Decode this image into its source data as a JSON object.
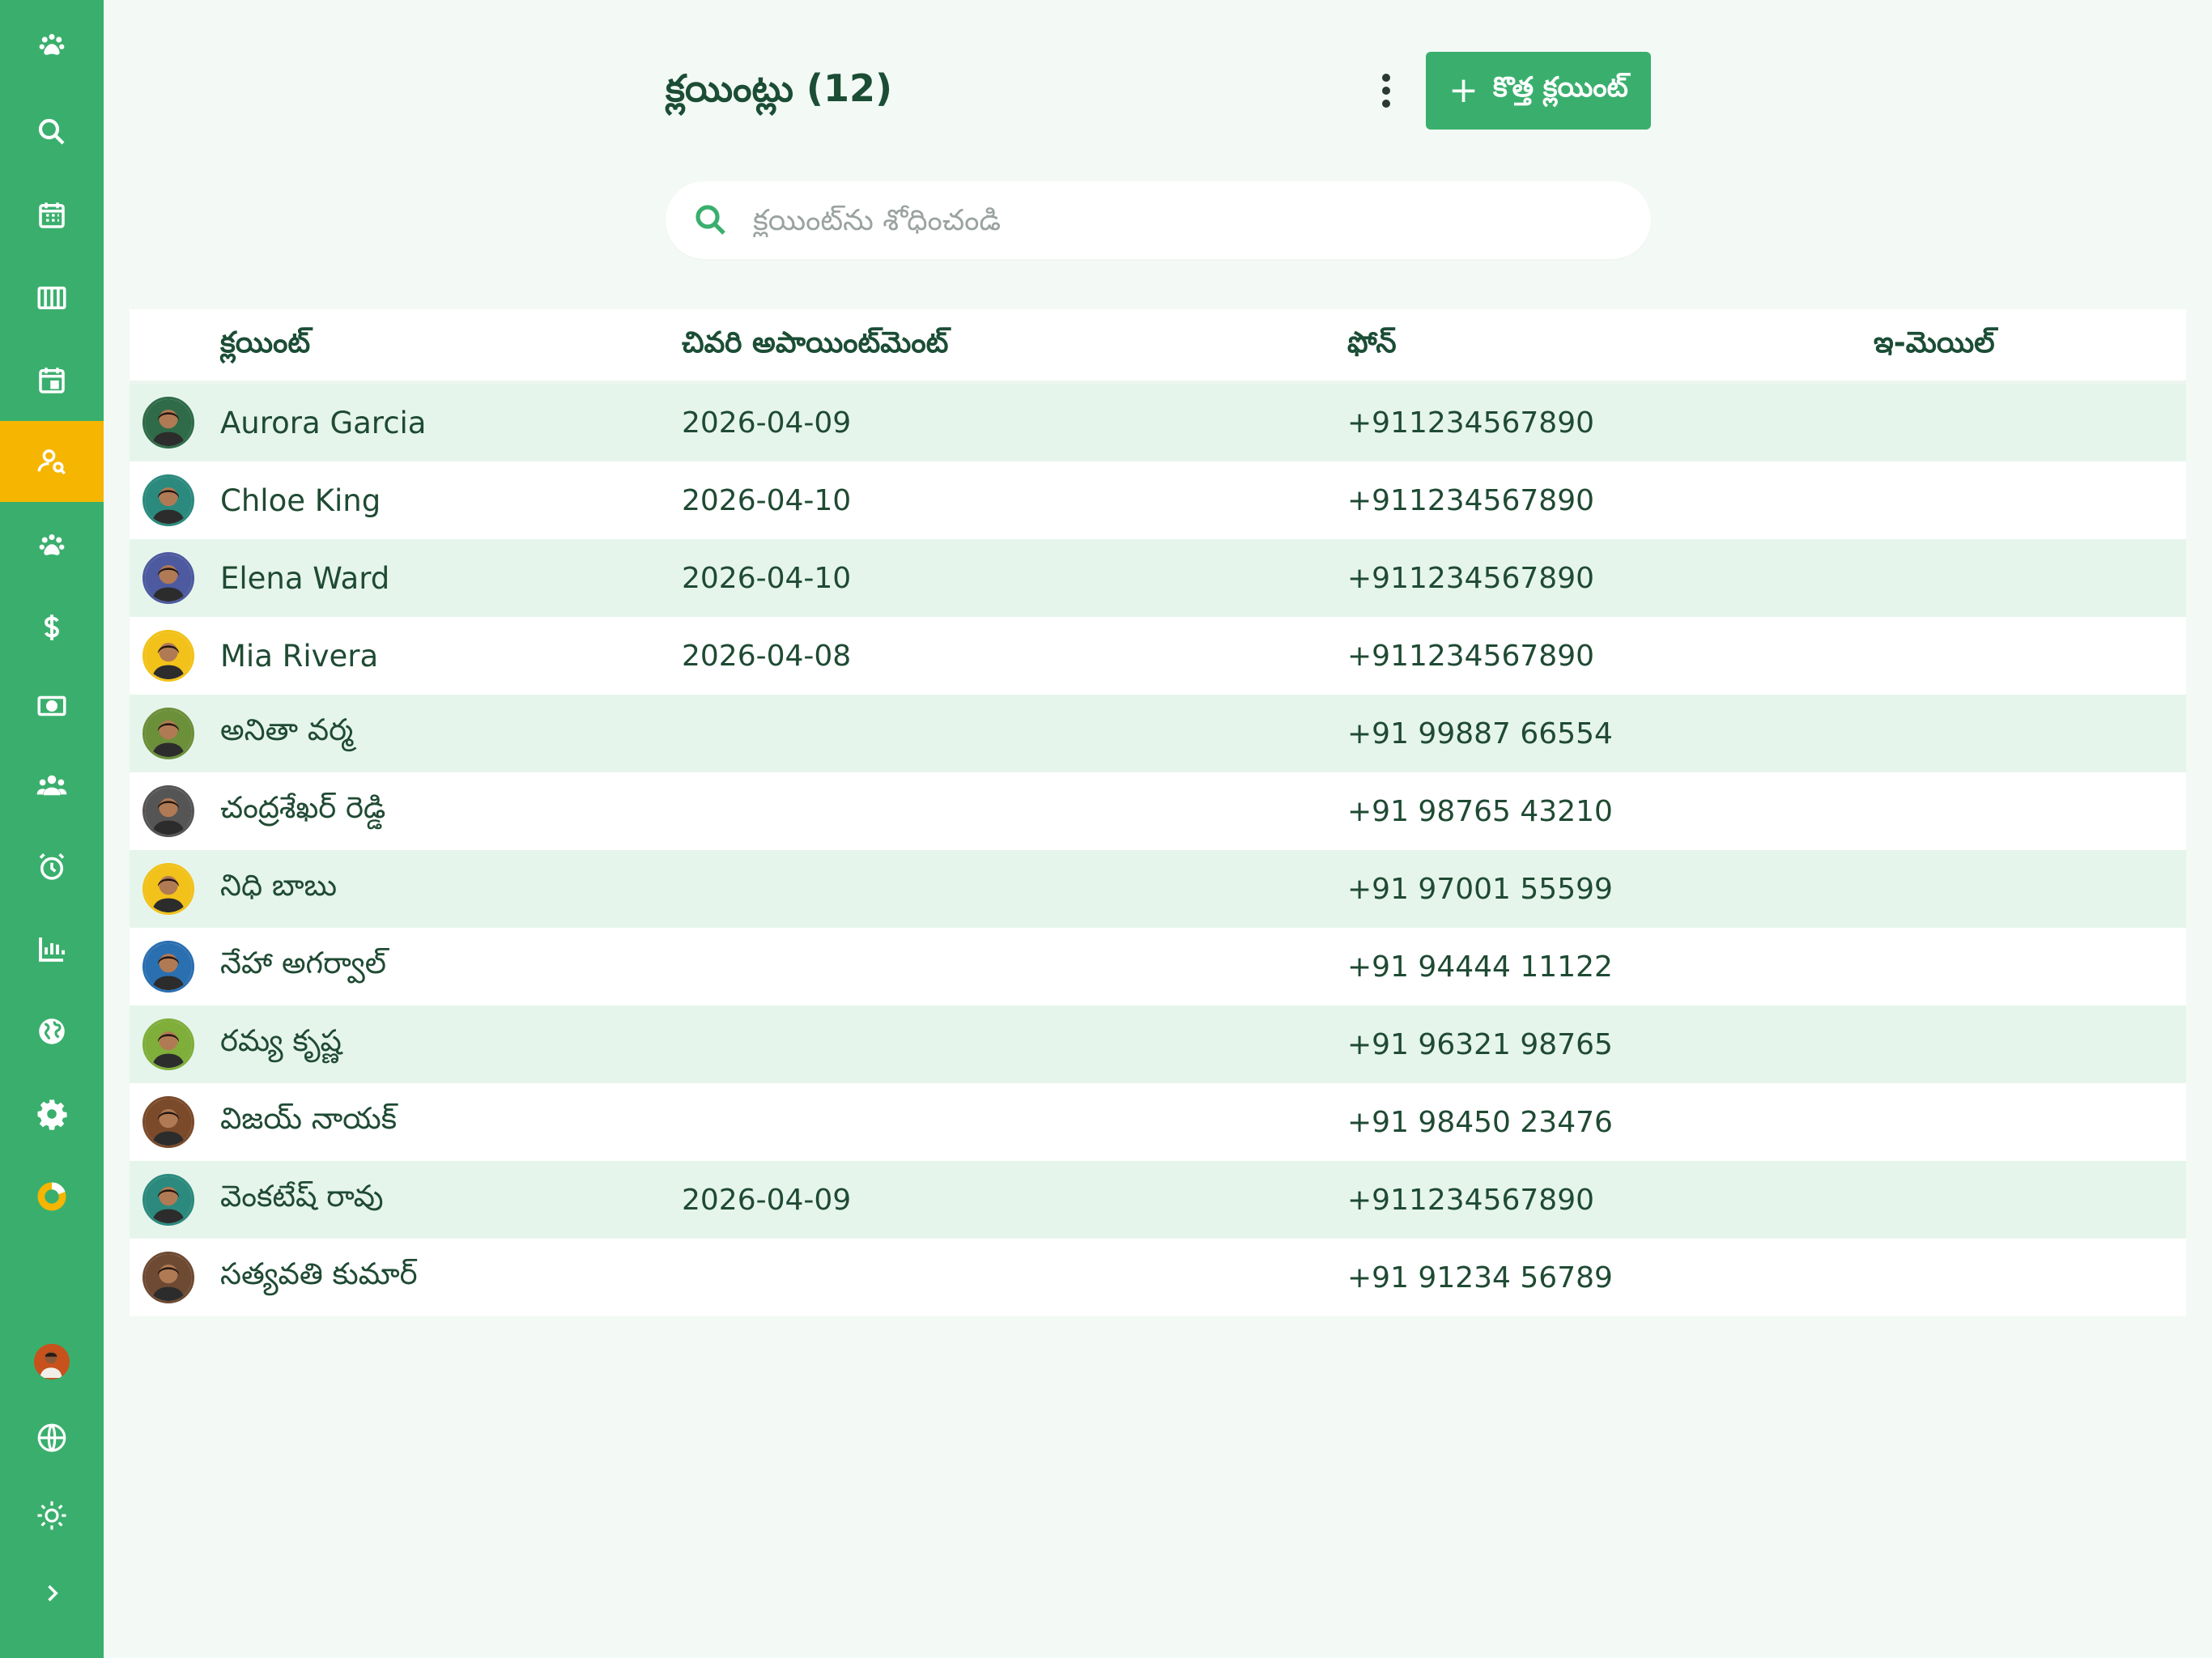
{
  "header": {
    "title": "క్లయింట్లు (12)",
    "new_button_label": "కొత్త క్లయింట్",
    "new_button_plus": "+"
  },
  "search": {
    "placeholder": "క్లయింట్‌ను శోధించండి",
    "value": ""
  },
  "table": {
    "columns": [
      "క్లయింట్",
      "చివరి అపాయింట్‌మెంట్",
      "ఫోన్",
      "ఇ-మెయిల్"
    ],
    "rows": [
      {
        "name": "Aurora Garcia",
        "last_appointment": "2026-04-09",
        "phone": "+911234567890",
        "email": "",
        "avatar_color": "#2f6b48"
      },
      {
        "name": "Chloe King",
        "last_appointment": "2026-04-10",
        "phone": "+911234567890",
        "email": "",
        "avatar_color": "#2b8a7d"
      },
      {
        "name": "Elena Ward",
        "last_appointment": "2026-04-10",
        "phone": "+911234567890",
        "email": "",
        "avatar_color": "#4d5aa0"
      },
      {
        "name": "Mia Rivera",
        "last_appointment": "2026-04-08",
        "phone": "+911234567890",
        "email": "",
        "avatar_color": "#f2c21a"
      },
      {
        "name": "అనితా వర్మ",
        "last_appointment": "",
        "phone": "+91 99887 66554",
        "email": "",
        "avatar_color": "#6c8f3a"
      },
      {
        "name": "చంద్రశేఖర్ రెడ్డి",
        "last_appointment": "",
        "phone": "+91 98765 43210",
        "email": "",
        "avatar_color": "#555555"
      },
      {
        "name": "నిధి బాబు",
        "last_appointment": "",
        "phone": "+91 97001 55599",
        "email": "",
        "avatar_color": "#f2c21a"
      },
      {
        "name": "నేహా అగర్వాల్",
        "last_appointment": "",
        "phone": "+91 94444 11122",
        "email": "",
        "avatar_color": "#2a6fb0"
      },
      {
        "name": "రమ్య కృష్ణ",
        "last_appointment": "",
        "phone": "+91 96321 98765",
        "email": "",
        "avatar_color": "#7fae3a"
      },
      {
        "name": "విజయ్ నాయక్",
        "last_appointment": "",
        "phone": "+91 98450 23476",
        "email": "",
        "avatar_color": "#7a4a2a"
      },
      {
        "name": "వెంకటేష్ రావు",
        "last_appointment": "2026-04-09",
        "phone": "+911234567890",
        "email": "",
        "avatar_color": "#2b8a7d"
      },
      {
        "name": "సత్యవతి కుమార్",
        "last_appointment": "",
        "phone": "+91 91234 56789",
        "email": "",
        "avatar_color": "#6e4a33"
      }
    ]
  },
  "sidebar": {
    "items": [
      {
        "icon": "paw-icon",
        "active": false
      },
      {
        "icon": "search-icon",
        "active": false
      },
      {
        "icon": "calendar-grid-icon",
        "active": false
      },
      {
        "icon": "columns-icon",
        "active": false
      },
      {
        "icon": "calendar-event-icon",
        "active": false
      },
      {
        "icon": "person-search-icon",
        "active": true
      },
      {
        "icon": "paw-icon",
        "active": false
      },
      {
        "icon": "dollar-icon",
        "active": false
      },
      {
        "icon": "cash-icon",
        "active": false
      },
      {
        "icon": "group-icon",
        "active": false
      },
      {
        "icon": "alarm-icon",
        "active": false
      },
      {
        "icon": "bar-chart-icon",
        "active": false
      },
      {
        "icon": "globe-icon",
        "active": false
      },
      {
        "icon": "gear-icon",
        "active": false
      },
      {
        "icon": "donut-icon",
        "active": false
      }
    ],
    "bottom": [
      "user-avatar",
      "language-globe-icon",
      "theme-sun-icon",
      "chevron-right-icon"
    ]
  },
  "colors": {
    "brand_green": "#3aaf6d",
    "active_yellow": "#f5b500",
    "row_alt": "#e6f5ec",
    "text_dark": "#1b4d35"
  }
}
